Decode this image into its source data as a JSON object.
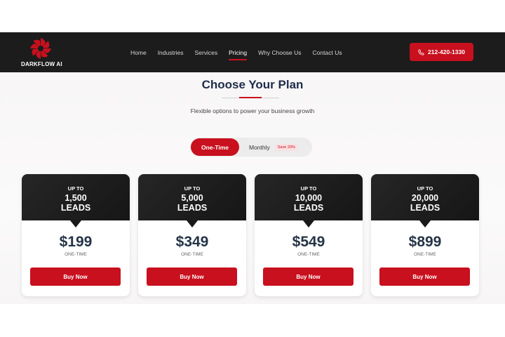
{
  "brand": {
    "name": "DARKFLOW AI",
    "logo_icon": "spiral-swirl-icon",
    "accent": "#c8101e"
  },
  "nav": {
    "items": [
      {
        "label": "Home",
        "active": false
      },
      {
        "label": "Industries",
        "active": false
      },
      {
        "label": "Services",
        "active": false
      },
      {
        "label": "Pricing",
        "active": true
      },
      {
        "label": "Why Choose Us",
        "active": false
      },
      {
        "label": "Contact Us",
        "active": false
      }
    ],
    "phone": {
      "icon": "phone-icon",
      "label": "212-420-1330"
    }
  },
  "pricing": {
    "title": "Choose Your Plan",
    "subtitle": "Flexible options to power your business growth",
    "toggle": {
      "one_time": "One-Time",
      "monthly": "Monthly",
      "save_badge": "Save 20%",
      "selected": "One-Time"
    },
    "plans": [
      {
        "up_to": "UP TO",
        "amount": "1,500",
        "unit": "LEADS",
        "price": "$199",
        "period": "ONE-TIME",
        "button": "Buy Now"
      },
      {
        "up_to": "UP TO",
        "amount": "5,000",
        "unit": "LEADS",
        "price": "$349",
        "period": "ONE-TIME",
        "button": "Buy Now"
      },
      {
        "up_to": "UP TO",
        "amount": "10,000",
        "unit": "LEADS",
        "price": "$549",
        "period": "ONE-TIME",
        "button": "Buy Now"
      },
      {
        "up_to": "UP TO",
        "amount": "20,000",
        "unit": "LEADS",
        "price": "$899",
        "period": "ONE-TIME",
        "button": "Buy Now"
      }
    ]
  }
}
